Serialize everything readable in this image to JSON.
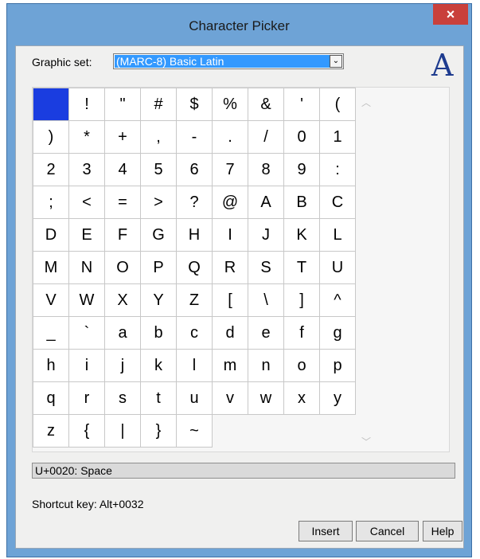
{
  "window": {
    "title": "Character Picker",
    "close_glyph": "×"
  },
  "graphic_set": {
    "label": "Graphic set:",
    "value": "(MARC-8) Basic Latin",
    "dropdown_glyph": "⌄"
  },
  "preview_char": "A",
  "grid": {
    "cells": [
      " ",
      "!",
      "\"",
      "#",
      "$",
      "%",
      "&",
      "'",
      "(",
      ")",
      "*",
      "+",
      ",",
      "-",
      ".",
      "/",
      "0",
      "1",
      "2",
      "3",
      "4",
      "5",
      "6",
      "7",
      "8",
      "9",
      ":",
      ";",
      "<",
      "=",
      ">",
      "?",
      "@",
      "A",
      "B",
      "C",
      "D",
      "E",
      "F",
      "G",
      "H",
      "I",
      "J",
      "K",
      "L",
      "M",
      "N",
      "O",
      "P",
      "Q",
      "R",
      "S",
      "T",
      "U",
      "V",
      "W",
      "X",
      "Y",
      "Z",
      "[",
      "\\",
      "]",
      "^",
      "_",
      "`",
      "a",
      "b",
      "c",
      "d",
      "e",
      "f",
      "g",
      "h",
      "i",
      "j",
      "k",
      "l",
      "m",
      "n",
      "o",
      "p",
      "q",
      "r",
      "s",
      "t",
      "u",
      "v",
      "w",
      "x",
      "y",
      "z",
      "{",
      "|",
      "}",
      "~"
    ],
    "selected_index": 0,
    "selected_color": "#1a3de0",
    "scroll_up_glyph": "︿",
    "scroll_down_glyph": "﹀"
  },
  "status": {
    "code_point": "U+0020: Space"
  },
  "shortcut": "Shortcut key: Alt+0032",
  "buttons": {
    "insert": "Insert",
    "cancel": "Cancel",
    "help": "Help"
  }
}
